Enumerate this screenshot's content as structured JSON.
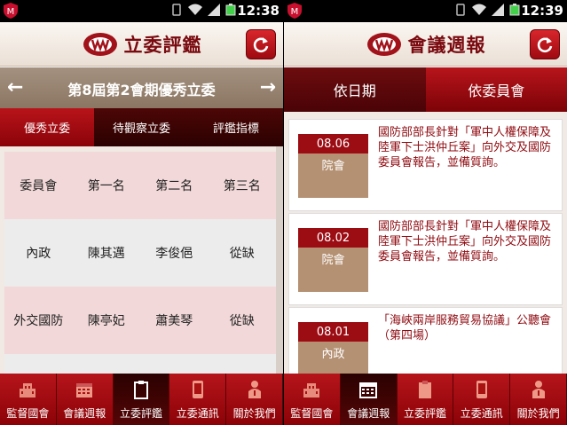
{
  "colors": {
    "brand_red": "#9c0c13",
    "dark_red": "#4a0306",
    "tan": "#b59173"
  },
  "status": {
    "left_time": "12:38",
    "right_time": "12:39"
  },
  "left": {
    "app_title": "立委評鑑",
    "period_title": "第8屆第2會期優秀立委",
    "subtabs": [
      "優秀立委",
      "待觀察立委",
      "評鑑指標"
    ],
    "table": {
      "header": [
        "委員會",
        "第一名",
        "第二名",
        "第三名"
      ],
      "rows": [
        [
          "內政",
          "陳其邁",
          "李俊俋",
          "從缺"
        ],
        [
          "外交國防",
          "陳亭妃",
          "蕭美琴",
          "從缺"
        ]
      ]
    }
  },
  "right": {
    "app_title": "會議週報",
    "tabs": [
      "依日期",
      "依委員會"
    ],
    "items": [
      {
        "date": "08.06",
        "category": "院會",
        "text": "國防部部長針對「軍中人權保障及陸軍下士洪仲丘案」向外交及國防委員會報告，並備質詢。"
      },
      {
        "date": "08.02",
        "category": "院會",
        "text": "國防部部長針對「軍中人權保障及陸軍下士洪仲丘案」向外交及國防委員會報告，並備質詢。"
      },
      {
        "date": "08.01",
        "category": "內政",
        "text": "「海峽兩岸服務貿易協議」公聽會（第四場）"
      }
    ]
  },
  "nav": {
    "items": [
      "監督國會",
      "會議週報",
      "立委評鑑",
      "立委通訊",
      "關於我們"
    ],
    "icons": [
      "building-icon",
      "calendar-icon",
      "clipboard-icon",
      "phone-icon",
      "person-info-icon"
    ],
    "left_active": 2,
    "right_active": 1
  }
}
